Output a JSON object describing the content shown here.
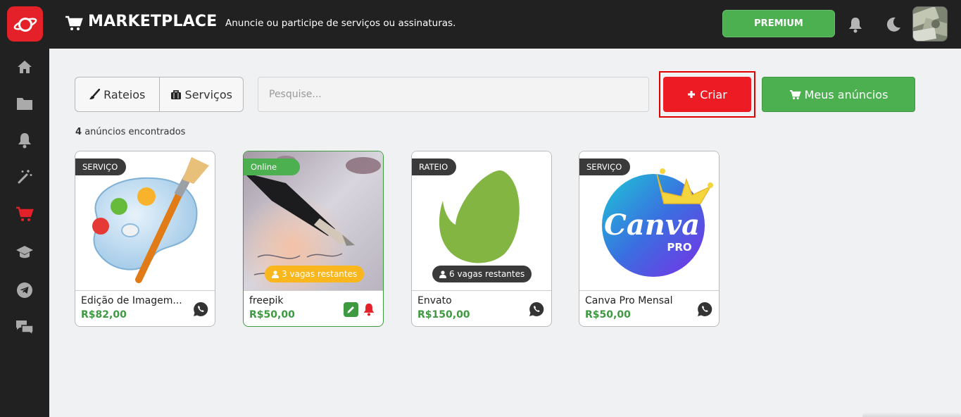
{
  "header": {
    "title": "MARKETPLACE",
    "subtitle": "Anuncie ou participe de serviços ou assinaturas.",
    "premium_label": "PREMIUM",
    "brand_color": "#e42129"
  },
  "sidebar": {
    "items": [
      {
        "name": "home",
        "icon": "home-icon"
      },
      {
        "name": "folder",
        "icon": "folder-icon"
      },
      {
        "name": "notifications",
        "icon": "bell-icon"
      },
      {
        "name": "magic",
        "icon": "magic-wand-icon"
      },
      {
        "name": "marketplace",
        "icon": "cart-icon",
        "active": true
      },
      {
        "name": "courses",
        "icon": "graduation-cap-icon"
      },
      {
        "name": "telegram",
        "icon": "telegram-icon"
      },
      {
        "name": "chat",
        "icon": "chat-icon"
      }
    ]
  },
  "toolbar": {
    "tab_rateios": "Rateios",
    "tab_servicos": "Serviços",
    "search_placeholder": "Pesquise...",
    "criar_label": "Criar",
    "meus_anuncios_label": "Meus anúncios"
  },
  "results": {
    "count": "4",
    "count_text": "anúncios encontrados"
  },
  "cards": [
    {
      "badge": "SERVIÇO",
      "title": "Edição de Imagem...",
      "price": "R$82,00",
      "action_icon": "whatsapp-icon"
    },
    {
      "badge": "Online",
      "title": "freepik",
      "price": "R$50,00",
      "vagas": "3 vagas restantes",
      "action_icons": [
        "edit-icon",
        "bell-icon"
      ]
    },
    {
      "badge": "RATEIO",
      "title": "Envato",
      "price": "R$150,00",
      "vagas": "6 vagas restantes",
      "action_icon": "whatsapp-icon"
    },
    {
      "badge": "SERVIÇO",
      "title": "Canva Pro Mensal",
      "price": "R$50,00",
      "action_icon": "whatsapp-icon",
      "logo_text": "Canva",
      "logo_sub": "PRO"
    }
  ]
}
